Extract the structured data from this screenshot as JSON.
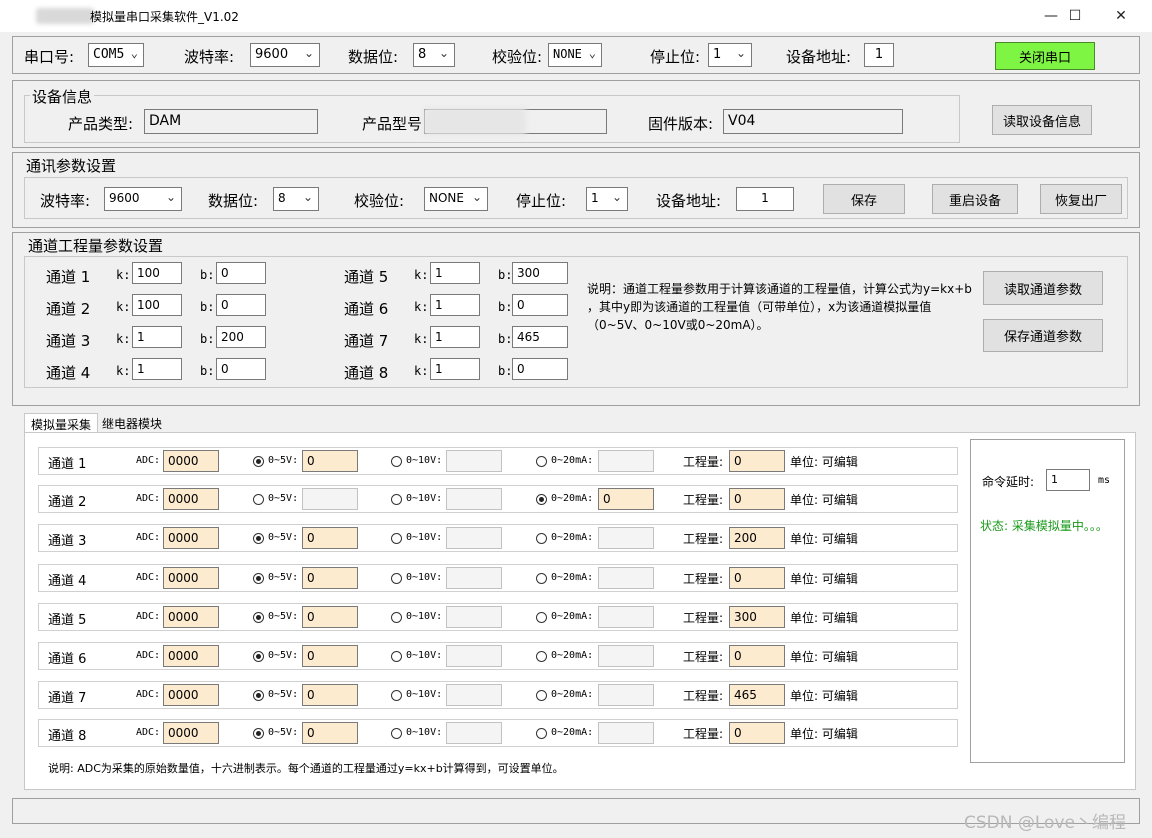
{
  "window": {
    "title": "模拟量串口采集软件_V1.02",
    "min": "—",
    "max": "☐",
    "close": "✕"
  },
  "serial": {
    "port_label": "串口号:",
    "port_value": "COM5",
    "baud_label": "波特率:",
    "baud_value": "9600",
    "data_label": "数据位:",
    "data_value": "8",
    "parity_label": "校验位:",
    "parity_value": "NONE",
    "stop_label": "停止位:",
    "stop_value": "1",
    "addr_label": "设备地址:",
    "addr_value": "1",
    "toggle_button": "关闭串口"
  },
  "device": {
    "group_title": "设备信息",
    "type_label": "产品类型:",
    "type_value": "DAM",
    "model_label": "产品型号",
    "model_value": "",
    "fw_label": "固件版本:",
    "fw_value": "V04",
    "read_button": "读取设备信息"
  },
  "comm": {
    "group_title": "通讯参数设置",
    "baud_label": "波特率:",
    "baud_value": "9600",
    "data_label": "数据位:",
    "data_value": "8",
    "parity_label": "校验位:",
    "parity_value": "NONE",
    "stop_label": "停止位:",
    "stop_value": "1",
    "addr_label": "设备地址:",
    "addr_value": "1",
    "save_button": "保存",
    "reboot_button": "重启设备",
    "factory_button": "恢复出厂"
  },
  "eng": {
    "group_title": "通道工程量参数设置",
    "k_label": "k:",
    "b_label": "b:",
    "channels": [
      {
        "name": "通道 1",
        "k": "100",
        "b": "0"
      },
      {
        "name": "通道 2",
        "k": "100",
        "b": "0"
      },
      {
        "name": "通道 3",
        "k": "1",
        "b": "200"
      },
      {
        "name": "通道 4",
        "k": "1",
        "b": "0"
      },
      {
        "name": "通道 5",
        "k": "1",
        "b": "300"
      },
      {
        "name": "通道 6",
        "k": "1",
        "b": "0"
      },
      {
        "name": "通道 7",
        "k": "1",
        "b": "465"
      },
      {
        "name": "通道 8",
        "k": "1",
        "b": "0"
      }
    ],
    "note_line1": "说明：通道工程量参数用于计算该通道的工程量值，计算公式为y=kx+b",
    "note_line2": "，其中y即为该通道的工程量值（可带单位），x为该通道模拟量值",
    "note_line3": "（0~5V、0~10V或0~20mA）。",
    "read_button": "读取通道参数",
    "save_button": "保存通道参数"
  },
  "tabs": [
    {
      "label": "模拟量采集"
    },
    {
      "label": "继电器模块"
    }
  ],
  "acq": {
    "adc_label": "ADC:",
    "r5_label": "0~5V:",
    "r10_label": "0~10V:",
    "r20_label": "0~20mA:",
    "eng_label": "工程量:",
    "unit_label": "单位: 可编辑",
    "rows": [
      {
        "name": "通道 1",
        "adc": "0000",
        "v5": "0",
        "v10": "",
        "ma": "",
        "eng": "0"
      },
      {
        "name": "通道 2",
        "adc": "0000",
        "v5": "",
        "v10": "",
        "ma": "0",
        "eng": "0"
      },
      {
        "name": "通道 3",
        "adc": "0000",
        "v5": "0",
        "v10": "",
        "ma": "",
        "eng": "200"
      },
      {
        "name": "通道 4",
        "adc": "0000",
        "v5": "0",
        "v10": "",
        "ma": "",
        "eng": "0"
      },
      {
        "name": "通道 5",
        "adc": "0000",
        "v5": "0",
        "v10": "",
        "ma": "",
        "eng": "300"
      },
      {
        "name": "通道 6",
        "adc": "0000",
        "v5": "0",
        "v10": "",
        "ma": "",
        "eng": "0"
      },
      {
        "name": "通道 7",
        "adc": "0000",
        "v5": "0",
        "v10": "",
        "ma": "",
        "eng": "465"
      },
      {
        "name": "通道 8",
        "adc": "0000",
        "v5": "0",
        "v10": "",
        "ma": "",
        "eng": "0"
      }
    ],
    "note": "说明: ADC为采集的原始数量值，十六进制表示。每个通道的工程量通过y=kx+b计算得到，可设置单位。"
  },
  "side": {
    "delay_label": "命令延时:",
    "delay_value": "1",
    "delay_unit": "ms",
    "status": "状态: 采集模拟量中。。。"
  },
  "watermark": "CSDN @Love丶编程",
  "colors": {
    "status_green": "#1a9a1a",
    "toggle_green": "#7ef542",
    "cream": "#fdebd0"
  }
}
